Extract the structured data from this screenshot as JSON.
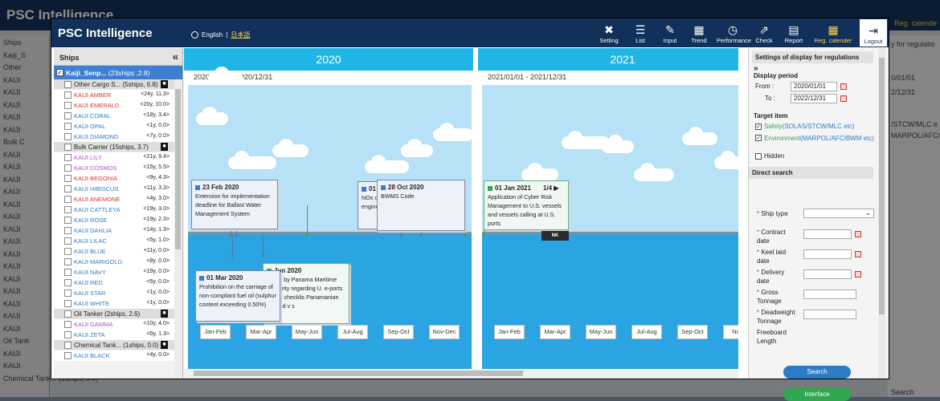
{
  "background": {
    "title": "PSC Intelligence",
    "side_rows": [
      "Ships",
      "Kaiji_S",
      "Other",
      "KAIJI",
      "KAIJI",
      "KAIJI",
      "KAIJI",
      "KAIJI",
      "Bulk C",
      "KAIJI",
      "KAIJI",
      "KAIJI",
      "KAIJI",
      "KAIJI",
      "KAIJI",
      "KAIJI",
      "KAIJI",
      "KAIJI",
      "KAIJI",
      "KAIJI",
      "KAIJI",
      "KAIJI",
      "KAIJI",
      "KAIJI",
      "Oil Tank",
      "KAIJI",
      "KAIJI",
      "Chemical Tank... (1ships, 0.0)"
    ],
    "right_rows": [
      "y for regulatio",
      "0/01/01",
      "2/12/31",
      "/STCW/MLC e",
      "MARPOL/AFC/",
      "Search"
    ],
    "reg_label": "Reg. calende"
  },
  "header": {
    "title": "PSC Intelligence",
    "lang_en": "English",
    "lang_sep": "|",
    "lang_jp": "日本語",
    "tools": [
      {
        "label": "Setting",
        "icon": "✖"
      },
      {
        "label": "List",
        "icon": "☰"
      },
      {
        "label": "Input",
        "icon": "✎"
      },
      {
        "label": "Trend",
        "icon": "▦"
      },
      {
        "label": "Performance",
        "icon": "◷"
      },
      {
        "label": "Check",
        "icon": "⇗"
      },
      {
        "label": "Report",
        "icon": "▤"
      },
      {
        "label": "Reg. calender",
        "icon": "▦"
      },
      {
        "label": "Logout",
        "icon": "⇥"
      }
    ]
  },
  "ships_panel": {
    "title": "Ships",
    "collapse": "«",
    "selected": "Kaiji_Senp...",
    "selected_info": "(23ships ,2.8)",
    "rows": [
      {
        "type": "group",
        "name": "Other Cargo S...",
        "info": "(5ships, 6.8)"
      },
      {
        "type": "ship",
        "name": "KAIJI AMBER",
        "info": "<24y, 11.3>",
        "color": "#d0392b"
      },
      {
        "type": "ship",
        "name": "KAIJI EMERALD",
        "info": "<20y, 10.0>",
        "color": "#d0392b"
      },
      {
        "type": "ship",
        "name": "KAIJI CORAL",
        "info": "<18y, 3.4>",
        "color": "#2d7bc4"
      },
      {
        "type": "ship",
        "name": "KAIJI OPAL",
        "info": "<1y, 0.0>",
        "color": "#2d7bc4"
      },
      {
        "type": "ship",
        "name": "KAIJI DIAMOND",
        "info": "<7y, 0.0>",
        "color": "#2d7bc4"
      },
      {
        "type": "group",
        "name": "Bulk Carrier",
        "info": "(15ships, 3.7)"
      },
      {
        "type": "ship",
        "name": "KAIJI LILY",
        "info": "<21y, 9.4>",
        "color": "#b04fc0"
      },
      {
        "type": "ship",
        "name": "KAIJI COSMOS",
        "info": "<15y, 5.5>",
        "color": "#b04fc0"
      },
      {
        "type": "ship",
        "name": "KAIJI BEGONIA",
        "info": "<9y, 4.3>",
        "color": "#d0392b"
      },
      {
        "type": "ship",
        "name": "KAIJI HIBISCUS",
        "info": "<11y, 3.3>",
        "color": "#2d7bc4"
      },
      {
        "type": "ship",
        "name": "KAIJI ANEMONE",
        "info": "<4y, 3.0>",
        "color": "#d0392b"
      },
      {
        "type": "ship",
        "name": "KAIJI CATTLEYA",
        "info": "<19y, 3.0>",
        "color": "#2d7bc4"
      },
      {
        "type": "ship",
        "name": "KAIJI ROSE",
        "info": "<19y, 2.3>",
        "color": "#2d7bc4"
      },
      {
        "type": "ship",
        "name": "KAIJI DAHLIA",
        "info": "<14y, 1.3>",
        "color": "#2d7bc4"
      },
      {
        "type": "ship",
        "name": "KAIJI LILAC",
        "info": "<5y, 1.0>",
        "color": "#2d7bc4"
      },
      {
        "type": "ship",
        "name": "KAIJI BLUE",
        "info": "<11y, 0.0>",
        "color": "#2d7bc4"
      },
      {
        "type": "ship",
        "name": "KAIJI MARIGOLD",
        "info": "<8y, 0.0>",
        "color": "#2d7bc4"
      },
      {
        "type": "ship",
        "name": "KAIJI NAVY",
        "info": "<19y, 0.0>",
        "color": "#2d7bc4"
      },
      {
        "type": "ship",
        "name": "KAIJI RED",
        "info": "<5y, 0.0>",
        "color": "#2d7bc4"
      },
      {
        "type": "ship",
        "name": "KAIJI STAR",
        "info": "<1y, 0.0>",
        "color": "#2d7bc4"
      },
      {
        "type": "ship",
        "name": "KAIJI WHITE",
        "info": "<1y, 0.0>",
        "color": "#2d7bc4"
      },
      {
        "type": "group",
        "name": "Oil Tanker",
        "info": "(2ships, 2.6)"
      },
      {
        "type": "ship",
        "name": "KAIJI GAMMA",
        "info": "<10y, 4.0>",
        "color": "#b04fc0"
      },
      {
        "type": "ship",
        "name": "KAIJI ZETA",
        "info": "<6y, 1.3>",
        "color": "#2d7bc4"
      },
      {
        "type": "group",
        "name": "Chemical Tank...",
        "info": "(1ships, 0.0)"
      },
      {
        "type": "ship",
        "name": "KAIJI BLACK",
        "info": "<4y, 0.0>",
        "color": "#2d7bc4"
      }
    ]
  },
  "timeline": {
    "years": [
      {
        "year": "2020",
        "period": "2020/01/01 - 2020/12/31",
        "months": [
          "Jan-Feb",
          "Mar-Apr",
          "May-Jun",
          "Jul-Aug",
          "Sep-Oct",
          "Nov-Dec"
        ]
      },
      {
        "year": "2021",
        "period": "2021/01/01 - 2021/12/31",
        "months": [
          "Jan-Feb",
          "Mar-Apr",
          "May-Jun",
          "Jul-Aug",
          "Sep-Oct",
          "Nov-"
        ]
      }
    ],
    "events": [
      {
        "date": "23 Feb 2020",
        "text": "Extension for implementation deadline for Ballast Water Management System"
      },
      {
        "date": "01 C",
        "text": "NOx c engine"
      },
      {
        "date": "28 Oct 2020",
        "text": "BWMS Code"
      },
      {
        "date": "01 Jan 2021",
        "page": "1/4",
        "text": "Application of Cyber Risk Management to U.S. vessels and vessels calling at U.S. ports"
      },
      {
        "date": "Jun 2020",
        "text": "uction by Panama Maritime Authority regarding U. e-ports arrival checklis Panamanian flagged v s"
      },
      {
        "date": "01 Mar 2020",
        "text": "Prohibition on the carriage of non-compliant fuel oil (sulphur content exceeding 0.50%)"
      }
    ],
    "ship_tag": "NK"
  },
  "regulation_panel": {
    "title": "Settings of display for regulations",
    "period_label": "Display period",
    "from_label": "From :",
    "from_value": "2020/01/01",
    "to_label": "To :",
    "to_value": "2022/12/31",
    "target_label": "Target item",
    "safety": "Safety",
    "safety_detail": "(SOLAS/STCW/MLC etc)",
    "environment": "Environment",
    "environment_detail": "(MARPOL/AFC/BWM etc)",
    "hidden": "Hidden",
    "direct_search": "Direct search",
    "fields": [
      "Ship type",
      "Contract date",
      "Keel laid date",
      "Delivery date",
      "Gross Tonnage",
      "Deadweight Tonnage",
      "Freeboard Length"
    ],
    "search_button": "Search",
    "interface_button": "Interface"
  }
}
